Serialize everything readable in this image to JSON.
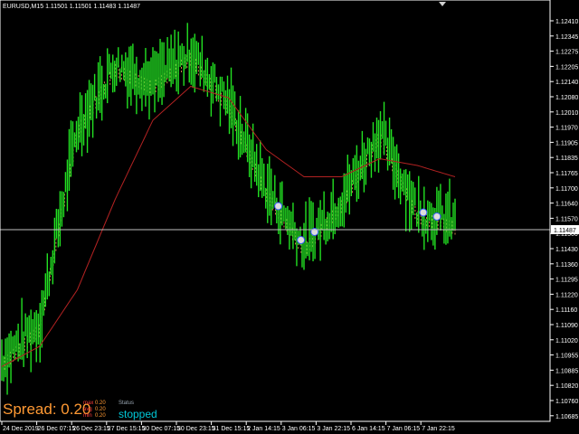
{
  "window": {
    "symbol_title": "EURUSD,M15  1.11501 1.11501 1.11483 1.11487"
  },
  "price_axis": {
    "ticks": [
      "1.12410",
      "1.12345",
      "1.12275",
      "1.12205",
      "1.12140",
      "1.12080",
      "1.12010",
      "1.11970",
      "1.11905",
      "1.11835",
      "1.11765",
      "1.11700",
      "1.11640",
      "1.11570",
      "1.11500",
      "1.11430",
      "1.11360",
      "1.11295",
      "1.11220",
      "1.11160",
      "1.11090",
      "1.11020",
      "1.10955",
      "1.10885",
      "1.10820",
      "1.10760",
      "1.10685"
    ],
    "current_price_label": "1.11487"
  },
  "time_axis": {
    "ticks": [
      "24 Dec 2019",
      "26 Dec 07:15",
      "26 Dec 23:15",
      "27 Dec 15:15",
      "30 Dec 07:15",
      "30 Dec 23:15",
      "31 Dec 15:15",
      "2 Jan 14:15",
      "3 Jan 06:15",
      "3 Jan 22:15",
      "6 Jan 14:15",
      "7 Jan 06:15",
      "7 Jan 22:15"
    ]
  },
  "spread_panel": {
    "spread_text": "Spread: 0.20",
    "stats": [
      {
        "label": "max",
        "value": "0.20"
      },
      {
        "label": "avg",
        "value": "0.20"
      },
      {
        "label": "min",
        "value": "0.20"
      }
    ],
    "status_label": "Status",
    "status_value": "stopped"
  },
  "colors": {
    "background": "#000000",
    "price_bars": "#22e022",
    "moving_average": "#b22222",
    "cloud": "#ffa060",
    "grid_line": "#c0c0c0",
    "spread_text": "#ff9933",
    "status_value": "#00c8d8"
  },
  "chart_data": {
    "type": "line",
    "x": [
      "24 Dec 2019",
      "26 Dec 07:15",
      "26 Dec 23:15",
      "27 Dec 15:15",
      "30 Dec 07:15",
      "30 Dec 23:15",
      "31 Dec 15:15",
      "2 Jan 14:15",
      "3 Jan 06:15",
      "3 Jan 22:15",
      "6 Jan 14:15",
      "7 Jan 06:15",
      "7 Jan 22:15"
    ],
    "series": [
      {
        "values": [
          1.1089,
          1.1105,
          1.1192,
          1.122,
          1.1212,
          1.1225,
          1.1203,
          1.1165,
          1.114,
          1.116,
          1.119,
          1.1155,
          1.115
        ]
      },
      {
        "values": [
          1.1086,
          1.1095,
          1.112,
          1.116,
          1.1195,
          1.121,
          1.1205,
          1.1182,
          1.117,
          1.117,
          1.1178,
          1.1175,
          1.117
        ]
      }
    ],
    "ylim": [
      1.1065,
      1.1245
    ],
    "current_price": 1.11487
  }
}
